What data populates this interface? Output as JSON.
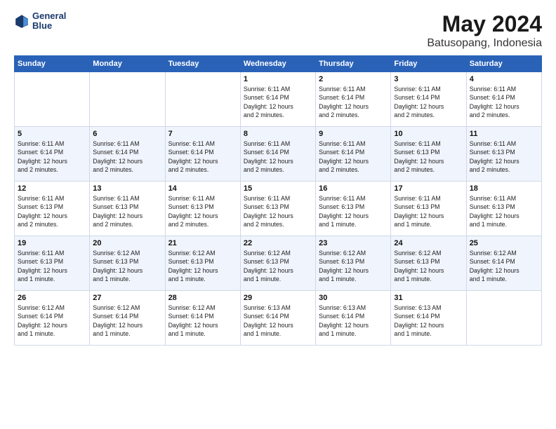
{
  "logo": {
    "line1": "General",
    "line2": "Blue"
  },
  "title": "May 2024",
  "subtitle": "Batusopang, Indonesia",
  "header": {
    "days": [
      "Sunday",
      "Monday",
      "Tuesday",
      "Wednesday",
      "Thursday",
      "Friday",
      "Saturday"
    ]
  },
  "weeks": [
    [
      {
        "num": "",
        "info": ""
      },
      {
        "num": "",
        "info": ""
      },
      {
        "num": "",
        "info": ""
      },
      {
        "num": "1",
        "info": "Sunrise: 6:11 AM\nSunset: 6:14 PM\nDaylight: 12 hours\nand 2 minutes."
      },
      {
        "num": "2",
        "info": "Sunrise: 6:11 AM\nSunset: 6:14 PM\nDaylight: 12 hours\nand 2 minutes."
      },
      {
        "num": "3",
        "info": "Sunrise: 6:11 AM\nSunset: 6:14 PM\nDaylight: 12 hours\nand 2 minutes."
      },
      {
        "num": "4",
        "info": "Sunrise: 6:11 AM\nSunset: 6:14 PM\nDaylight: 12 hours\nand 2 minutes."
      }
    ],
    [
      {
        "num": "5",
        "info": "Sunrise: 6:11 AM\nSunset: 6:14 PM\nDaylight: 12 hours\nand 2 minutes."
      },
      {
        "num": "6",
        "info": "Sunrise: 6:11 AM\nSunset: 6:14 PM\nDaylight: 12 hours\nand 2 minutes."
      },
      {
        "num": "7",
        "info": "Sunrise: 6:11 AM\nSunset: 6:14 PM\nDaylight: 12 hours\nand 2 minutes."
      },
      {
        "num": "8",
        "info": "Sunrise: 6:11 AM\nSunset: 6:14 PM\nDaylight: 12 hours\nand 2 minutes."
      },
      {
        "num": "9",
        "info": "Sunrise: 6:11 AM\nSunset: 6:14 PM\nDaylight: 12 hours\nand 2 minutes."
      },
      {
        "num": "10",
        "info": "Sunrise: 6:11 AM\nSunset: 6:13 PM\nDaylight: 12 hours\nand 2 minutes."
      },
      {
        "num": "11",
        "info": "Sunrise: 6:11 AM\nSunset: 6:13 PM\nDaylight: 12 hours\nand 2 minutes."
      }
    ],
    [
      {
        "num": "12",
        "info": "Sunrise: 6:11 AM\nSunset: 6:13 PM\nDaylight: 12 hours\nand 2 minutes."
      },
      {
        "num": "13",
        "info": "Sunrise: 6:11 AM\nSunset: 6:13 PM\nDaylight: 12 hours\nand 2 minutes."
      },
      {
        "num": "14",
        "info": "Sunrise: 6:11 AM\nSunset: 6:13 PM\nDaylight: 12 hours\nand 2 minutes."
      },
      {
        "num": "15",
        "info": "Sunrise: 6:11 AM\nSunset: 6:13 PM\nDaylight: 12 hours\nand 2 minutes."
      },
      {
        "num": "16",
        "info": "Sunrise: 6:11 AM\nSunset: 6:13 PM\nDaylight: 12 hours\nand 1 minute."
      },
      {
        "num": "17",
        "info": "Sunrise: 6:11 AM\nSunset: 6:13 PM\nDaylight: 12 hours\nand 1 minute."
      },
      {
        "num": "18",
        "info": "Sunrise: 6:11 AM\nSunset: 6:13 PM\nDaylight: 12 hours\nand 1 minute."
      }
    ],
    [
      {
        "num": "19",
        "info": "Sunrise: 6:11 AM\nSunset: 6:13 PM\nDaylight: 12 hours\nand 1 minute."
      },
      {
        "num": "20",
        "info": "Sunrise: 6:12 AM\nSunset: 6:13 PM\nDaylight: 12 hours\nand 1 minute."
      },
      {
        "num": "21",
        "info": "Sunrise: 6:12 AM\nSunset: 6:13 PM\nDaylight: 12 hours\nand 1 minute."
      },
      {
        "num": "22",
        "info": "Sunrise: 6:12 AM\nSunset: 6:13 PM\nDaylight: 12 hours\nand 1 minute."
      },
      {
        "num": "23",
        "info": "Sunrise: 6:12 AM\nSunset: 6:13 PM\nDaylight: 12 hours\nand 1 minute."
      },
      {
        "num": "24",
        "info": "Sunrise: 6:12 AM\nSunset: 6:13 PM\nDaylight: 12 hours\nand 1 minute."
      },
      {
        "num": "25",
        "info": "Sunrise: 6:12 AM\nSunset: 6:14 PM\nDaylight: 12 hours\nand 1 minute."
      }
    ],
    [
      {
        "num": "26",
        "info": "Sunrise: 6:12 AM\nSunset: 6:14 PM\nDaylight: 12 hours\nand 1 minute."
      },
      {
        "num": "27",
        "info": "Sunrise: 6:12 AM\nSunset: 6:14 PM\nDaylight: 12 hours\nand 1 minute."
      },
      {
        "num": "28",
        "info": "Sunrise: 6:12 AM\nSunset: 6:14 PM\nDaylight: 12 hours\nand 1 minute."
      },
      {
        "num": "29",
        "info": "Sunrise: 6:13 AM\nSunset: 6:14 PM\nDaylight: 12 hours\nand 1 minute."
      },
      {
        "num": "30",
        "info": "Sunrise: 6:13 AM\nSunset: 6:14 PM\nDaylight: 12 hours\nand 1 minute."
      },
      {
        "num": "31",
        "info": "Sunrise: 6:13 AM\nSunset: 6:14 PM\nDaylight: 12 hours\nand 1 minute."
      },
      {
        "num": "",
        "info": ""
      }
    ]
  ]
}
